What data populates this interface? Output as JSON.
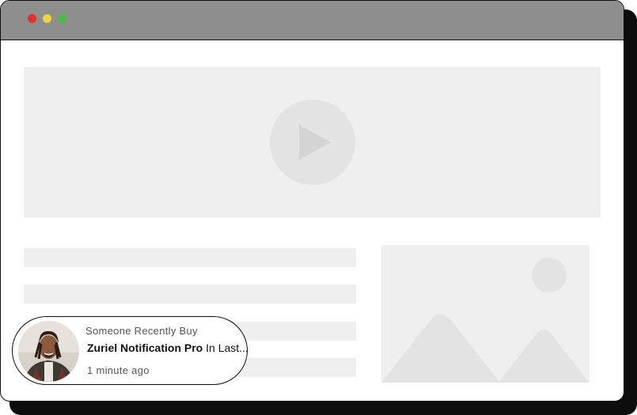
{
  "window": {
    "controls": [
      "close",
      "minimize",
      "maximize"
    ],
    "colors": {
      "titlebar": "#8e8e8e",
      "placeholder": "#efefef",
      "close": "#e5312b",
      "minimize": "#f1d33d",
      "maximize": "#4cba46"
    }
  },
  "content": {
    "video_icon": "play-icon",
    "image_icon": "image-placeholder-icon"
  },
  "notification": {
    "label": "Someone Recently Buy",
    "product_name": "Zuriel Notification Pro",
    "product_suffix": " In Last...",
    "time": "1 minute ago",
    "avatar_icon": "person-avatar"
  }
}
